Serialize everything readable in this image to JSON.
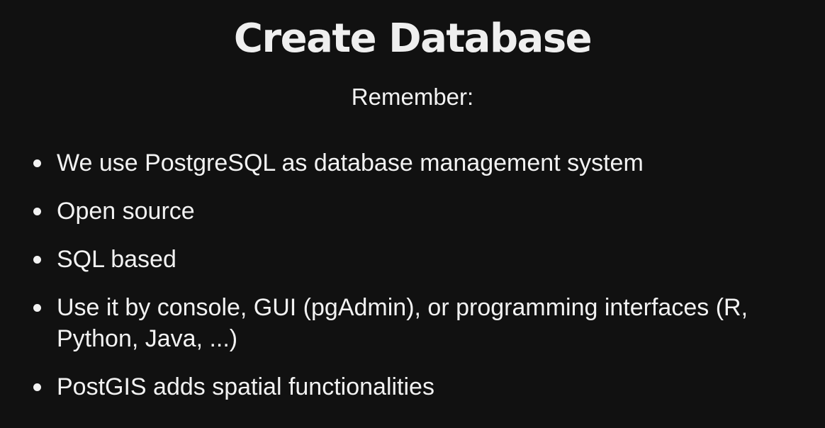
{
  "slide": {
    "title": "Create Database",
    "subtitle": "Remember:",
    "bullets": [
      "We use PostgreSQL as database management system",
      "Open source",
      "SQL based",
      "Use it by console, GUI (pgAdmin), or programming interfaces (R, Python, Java, ...)",
      "PostGIS adds spatial functionalities"
    ]
  },
  "colors": {
    "background": "#111111",
    "text": "#f2f2f2"
  }
}
